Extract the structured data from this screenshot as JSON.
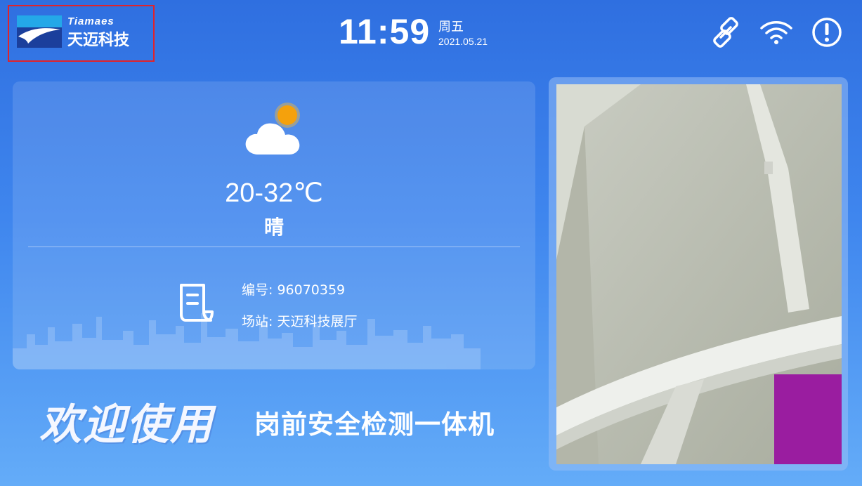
{
  "header": {
    "logo": {
      "en": "Tiamaes",
      "cn": "天迈科技"
    },
    "time": "11:59",
    "weekday": "周五",
    "date": "2021.05.21",
    "icons": [
      "link-icon",
      "wifi-icon",
      "alert-icon"
    ]
  },
  "weather": {
    "icon": "partly-cloudy-icon",
    "temperature": "20-32℃",
    "condition": "晴"
  },
  "device": {
    "icon": "document-icon",
    "number": "编号: 96070359",
    "station": "场站: 天迈科技展厅"
  },
  "welcome": {
    "title": "欢迎使用",
    "product": "岗前安全检测一体机"
  },
  "camera": {
    "label": "camera-preview"
  },
  "colors": {
    "accent": "#e0232b",
    "sun": "#f5a10c",
    "background_top": "#2f6fe0",
    "background_bottom": "#64acf8",
    "camera_overlay": "#9a1da0"
  }
}
